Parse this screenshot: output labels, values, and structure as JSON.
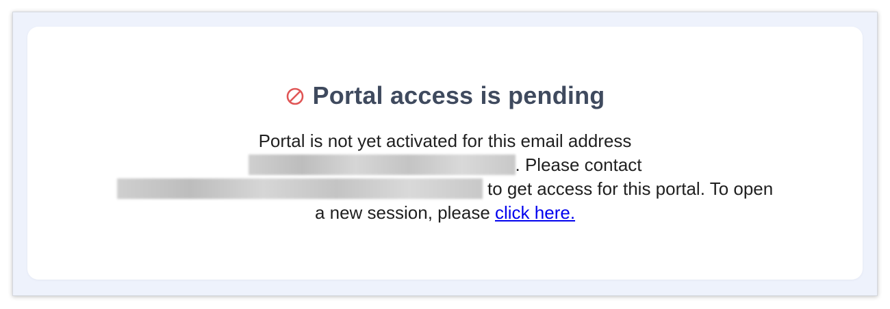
{
  "colors": {
    "page_background": "#eef2fc",
    "card_background": "#ffffff",
    "heading": "#3f4a5e",
    "icon": "#e05555",
    "link": "#0000ee"
  },
  "heading": {
    "icon": "ban-icon",
    "title": "Portal access is pending"
  },
  "message": {
    "line1": "Portal is not yet activated for this email address",
    "line2_suffix": ". Please contact",
    "line3_suffix": " to get access for this portal. To open",
    "line4_prefix": "a new session, please ",
    "link_text": "click here."
  }
}
